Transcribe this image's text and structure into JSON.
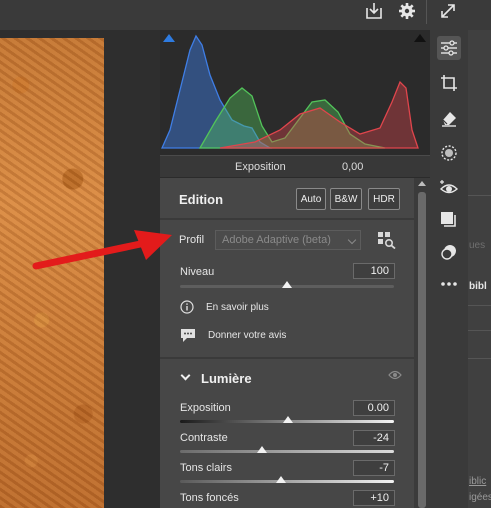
{
  "toolbar": {
    "icons": [
      "export-icon",
      "gear-icon",
      "expand-icon"
    ]
  },
  "histogram": {
    "readout_label": "Exposition",
    "readout_value": "0,00",
    "colors": {
      "red": "#e0454c",
      "green": "#52c45a",
      "blue": "#3f7ee6"
    }
  },
  "edit_panel": {
    "title": "Edition",
    "buttons": {
      "auto": "Auto",
      "bw": "B&W",
      "hdr": "HDR"
    },
    "profile": {
      "label": "Profil",
      "value": "Adobe Adaptive (beta)"
    },
    "amount": {
      "label": "Niveau",
      "value": "100",
      "level_percent": 100
    },
    "links": {
      "learn_more": "En savoir plus",
      "feedback": "Donner votre avis"
    }
  },
  "light_section": {
    "title": "Lumière",
    "sliders": [
      {
        "label": "Exposition",
        "value": "0.00"
      },
      {
        "label": "Contraste",
        "value": "-24"
      },
      {
        "label": "Tons clairs",
        "value": "-7"
      },
      {
        "label": "Tons foncés",
        "value": "+10"
      }
    ]
  },
  "tool_rail": {
    "icons": [
      "edit-sliders-icon",
      "crop-icon",
      "eraser-icon",
      "mask-icon",
      "redeye-icon",
      "presets-icon",
      "snapshots-icon",
      "more-icon"
    ]
  },
  "side_panel_cutoff": {
    "items": [
      "ues",
      "bibl",
      "iblic",
      "igées"
    ]
  }
}
